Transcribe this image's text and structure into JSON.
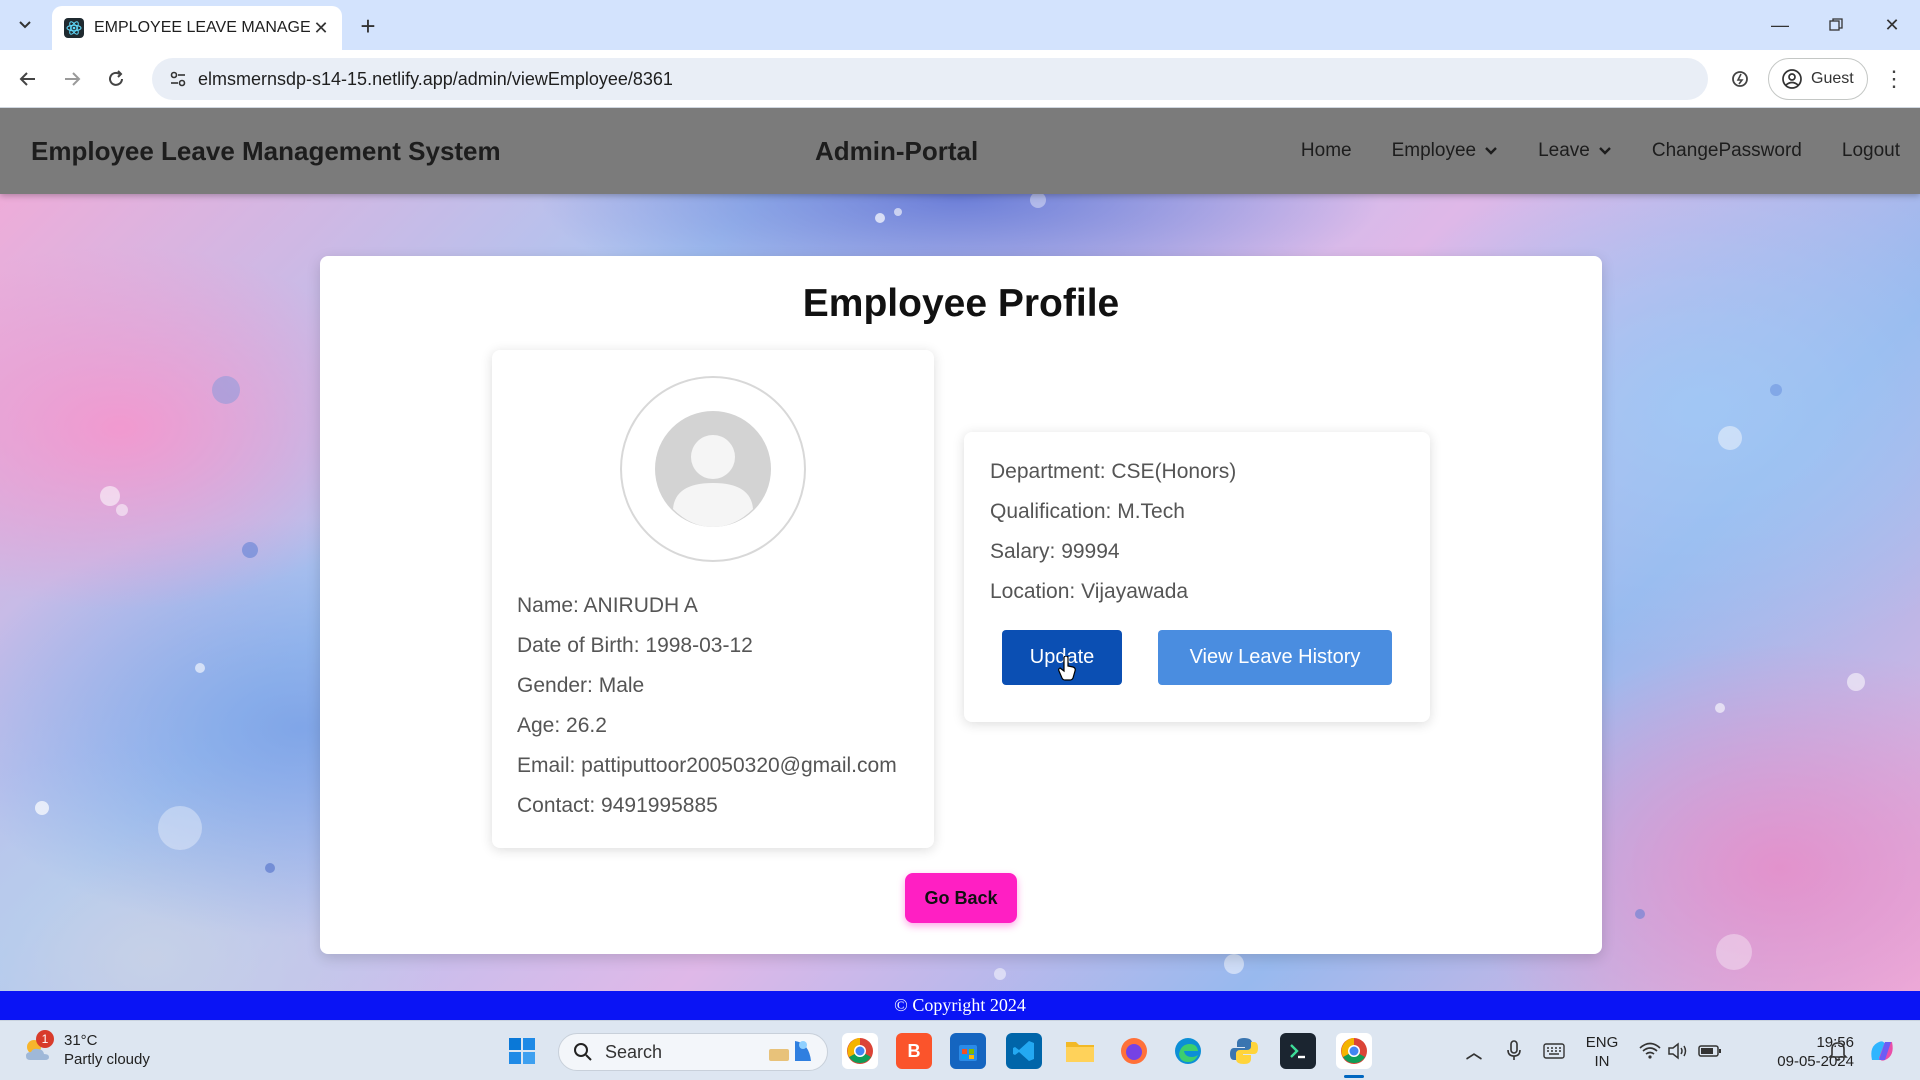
{
  "browser": {
    "tab_title": "EMPLOYEE LEAVE MANAGEMEN",
    "url": "elmsmernsdp-s14-15.netlify.app/admin/viewEmployee/8361",
    "profile_label": "Guest"
  },
  "navbar": {
    "brand": "Employee Leave Management System",
    "portal": "Admin-Portal",
    "links": {
      "home": "Home",
      "employee": "Employee",
      "leave": "Leave",
      "change_password": "ChangePassword",
      "logout": "Logout"
    }
  },
  "profile": {
    "title": "Employee Profile",
    "personal": {
      "name": "Name: ANIRUDH A",
      "dob": "Date of Birth: 1998-03-12",
      "gender": "Gender: Male",
      "age": "Age: 26.2",
      "email": "Email: pattiputtoor20050320@gmail.com",
      "contact": "Contact: 9491995885"
    },
    "work": {
      "department": "Department: CSE(Honors)",
      "qualification": "Qualification: M.Tech",
      "salary": "Salary: 99994",
      "location": "Location: Vijayawada"
    },
    "buttons": {
      "update": "Update",
      "view_history": "View Leave History",
      "go_back": "Go Back"
    }
  },
  "footer": {
    "copyright": "© Copyright 2024"
  },
  "taskbar": {
    "weather_temp": "31°C",
    "weather_desc": "Partly cloudy",
    "weather_badge": "1",
    "search_label": "Search",
    "lang_1": "ENG",
    "lang_2": "IN",
    "time": "19:56",
    "date": "09-05-2024"
  },
  "colors": {
    "navbar_bg": "#7b7b7b",
    "update_button": "#0b4fb3",
    "history_button": "#4a8de0",
    "go_back_button": "#ff1fc3",
    "footer_bg": "#0a14f5"
  }
}
